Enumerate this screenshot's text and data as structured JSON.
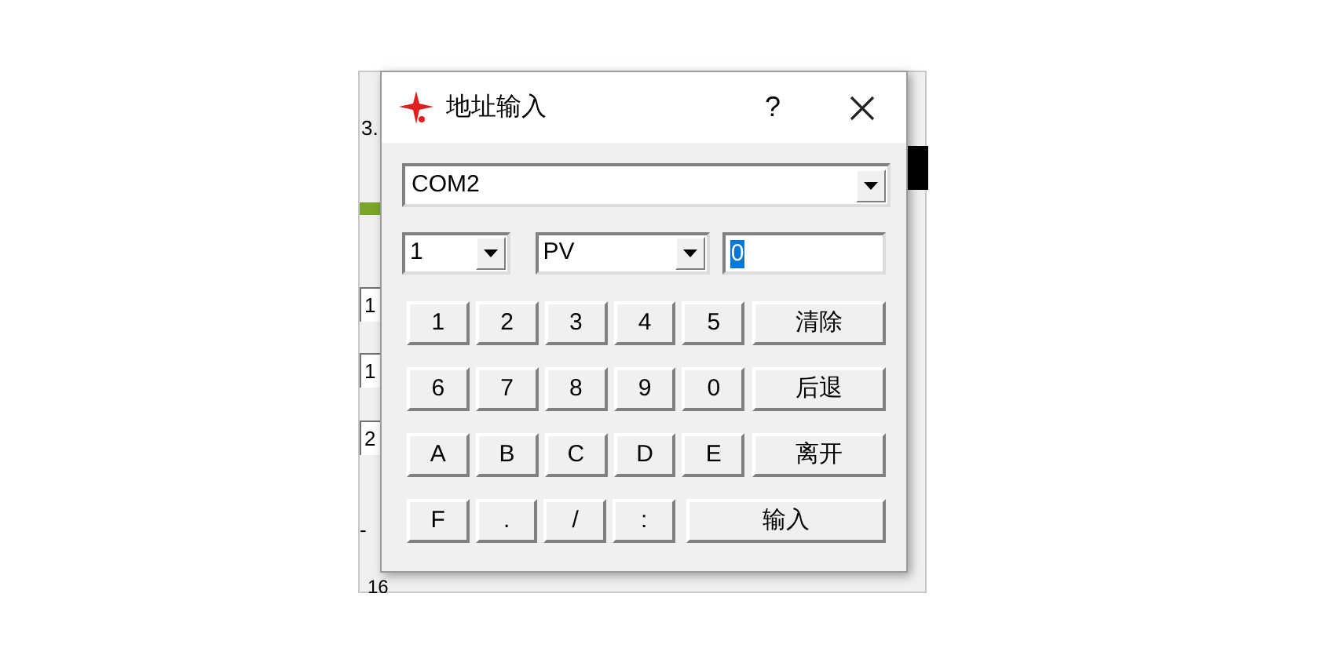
{
  "background_window": {
    "fragments": [
      {
        "text": "3.",
        "kind": "label"
      },
      {
        "text": "1",
        "kind": "field"
      },
      {
        "text": "1",
        "kind": "field"
      },
      {
        "text": "2",
        "kind": "field"
      },
      {
        "text": "-",
        "kind": "label"
      },
      {
        "text": "16",
        "kind": "combo"
      }
    ]
  },
  "dialog": {
    "title": "地址输入",
    "help": "?",
    "port": {
      "value": "COM2"
    },
    "station": {
      "value": "1"
    },
    "register": {
      "value": "PV"
    },
    "address": {
      "value": "0",
      "selected": true
    },
    "key_rows": [
      [
        {
          "label": "1",
          "kind": "small"
        },
        {
          "label": "2",
          "kind": "small"
        },
        {
          "label": "3",
          "kind": "small"
        },
        {
          "label": "4",
          "kind": "small"
        },
        {
          "label": "5",
          "kind": "small"
        },
        {
          "label": "清除",
          "kind": "wide"
        }
      ],
      [
        {
          "label": "6",
          "kind": "small"
        },
        {
          "label": "7",
          "kind": "small"
        },
        {
          "label": "8",
          "kind": "small"
        },
        {
          "label": "9",
          "kind": "small"
        },
        {
          "label": "0",
          "kind": "small"
        },
        {
          "label": "后退",
          "kind": "wide"
        }
      ],
      [
        {
          "label": "A",
          "kind": "small"
        },
        {
          "label": "B",
          "kind": "small"
        },
        {
          "label": "C",
          "kind": "small"
        },
        {
          "label": "D",
          "kind": "small"
        },
        {
          "label": "E",
          "kind": "small"
        },
        {
          "label": "离开",
          "kind": "wide"
        }
      ],
      [
        {
          "label": "F",
          "kind": "small"
        },
        {
          "label": ".",
          "kind": "small"
        },
        {
          "label": "/",
          "kind": "small"
        },
        {
          "label": ":",
          "kind": "small"
        },
        {
          "label": "输入",
          "kind": "widest"
        }
      ]
    ]
  }
}
